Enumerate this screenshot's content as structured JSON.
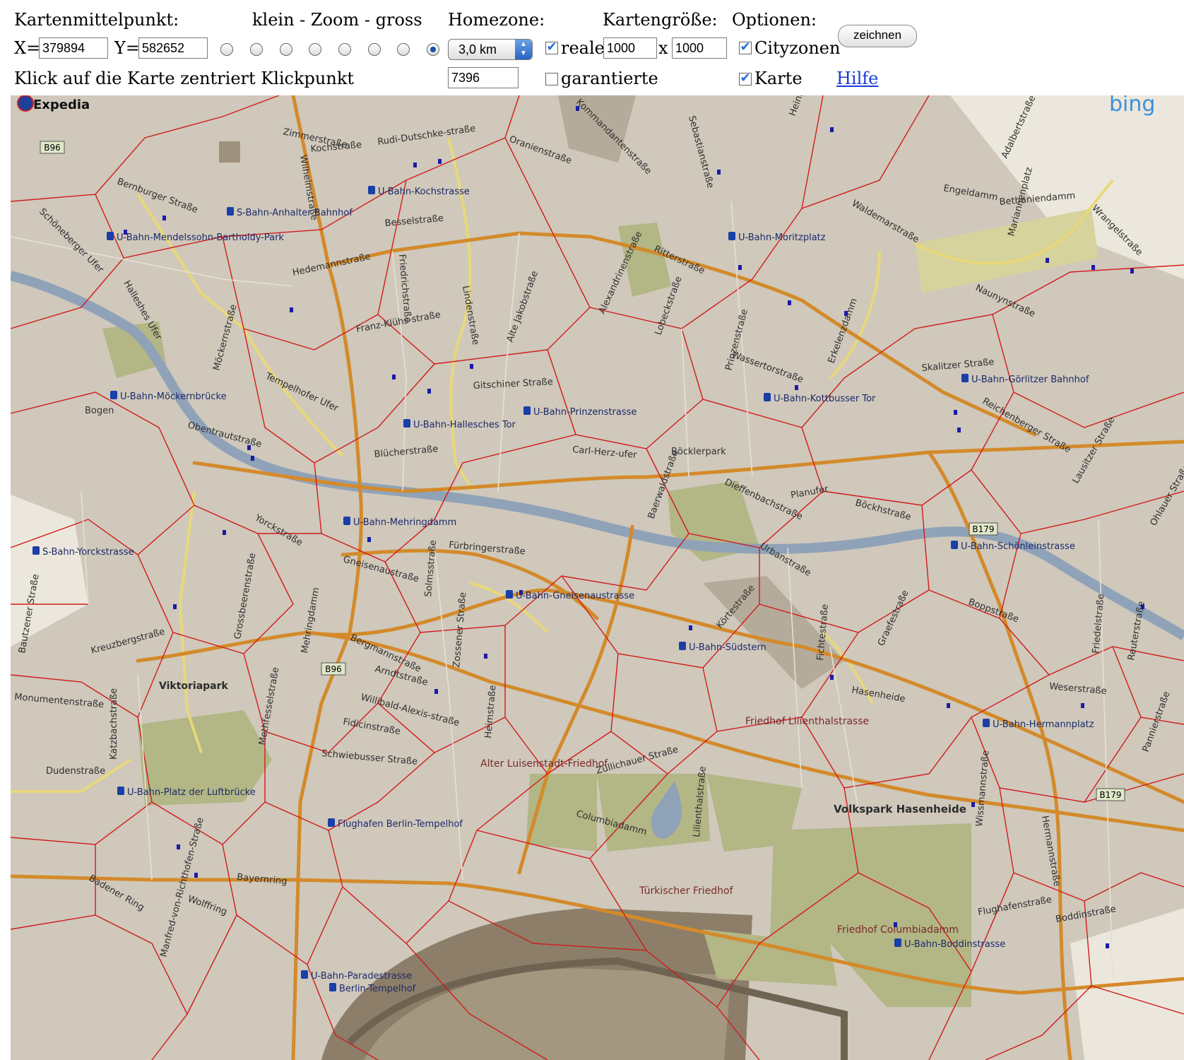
{
  "controls": {
    "center_label": "Kartenmittelpunkt:",
    "zoom_label": "klein - Zoom - gross",
    "homezone_label": "Homezone:",
    "size_label": "Kartengröße:",
    "options_label": "Optionen:",
    "x_prefix": "X=",
    "x_value": "379894",
    "y_prefix": "Y=",
    "y_value": "582652",
    "zoom_levels": 8,
    "zoom_selected": 8,
    "homezone_value": "3,0 km",
    "reale_checked": true,
    "reale_label": "reale",
    "width_value": "1000",
    "size_sep": "x",
    "height_value": "1000",
    "cityzonen_checked": true,
    "cityzonen_label": "Cityzonen",
    "draw_button": "zeichnen",
    "click_hint": "Klick auf die Karte zentriert Klickpunkt",
    "homezone_count": "7396",
    "garantierte_checked": false,
    "garantierte_label": "garantierte",
    "karte_checked": true,
    "karte_label": "Karte",
    "help_link": "Hilfe"
  },
  "map": {
    "colors": {
      "land": "#cfc8bb",
      "park": "#b3b685",
      "water": "#8fa2b8",
      "zone_lines": "#d21b1b",
      "main_roads": "#d48a2a",
      "yellow_roads": "#e8d87a",
      "label": "#333333",
      "poi": "#1b1ba8"
    },
    "logos": {
      "expedia": "Expedia",
      "bing": "bing"
    },
    "road_shields": [
      "B96",
      "B96",
      "B179",
      "B179"
    ],
    "street_labels": [
      "Zimmerstraße",
      "Kochstraße",
      "Rudi-Dutschke-straße",
      "Oranienstraße",
      "Kommandantenstraße",
      "Sebastianstraße",
      "Heinrich-Heine-Straße",
      "Adalbertstraße",
      "Engeldamm",
      "Bethaniendamm",
      "Waldemarstraße",
      "Wrangelstraße",
      "Mariannenplatz",
      "Bernburger Straße",
      "Schöneberger Ufer",
      "Wilhelmstraße",
      "Besselstraße",
      "Hedemannstraße",
      "Friedrichstraße",
      "Ritterstraße",
      "Alexandrinenstraße",
      "Naunynstraße",
      "Lindenstraße",
      "Alte Jakobstraße",
      "Franz-Klühs-straße",
      "Lobeckstraße",
      "Prinzenstraße",
      "Wassertorstraße",
      "Erkelenzdamm",
      "Skalitzer Straße",
      "Halleshes Ufer",
      "Möckernstraße",
      "Tempelhofer Ufer",
      "Gitschiner Straße",
      "Reichenberger Straße",
      "Obentrautstraße",
      "Böckhstraße",
      "Carl-Herz-ufer",
      "Blücherstraße",
      "Baerwaldstraße",
      "Planufer",
      "Dieffenbachstraße",
      "Urbanstraße",
      "Yorckstraße",
      "Mehringdamm",
      "Fürbringerstraße",
      "Gneisenaustraße",
      "Solmsstraße",
      "Zossener Straße",
      "Bergmannstraße",
      "Kreuzbergstraße",
      "Grossbeerenstraße",
      "Körtestraße",
      "Fichtestraße",
      "Graefestraße",
      "Boppstraße",
      "Hasenheide",
      "Weserstraße",
      "Monumentenstraße",
      "Katzbachstraße",
      "Methfesselstraße",
      "Arndtstraße",
      "Willibald-Alexis-straße",
      "Fidicinstraße",
      "Schwiebusser Straße",
      "Heimstraße",
      "Züllichauer Straße",
      "Lilienthalstraße",
      "Dudenstraße",
      "Columbiadamm",
      "Badener Ring",
      "Bayernring",
      "Wolffring",
      "Flughafenstraße",
      "Boddinstraße",
      "Hermannstraße",
      "Friedelstraße",
      "Reuterstraße",
      "Pannierstraße",
      "Bautzener Straße",
      "Ohlauer Straße",
      "Lausitzer Straße",
      "Wissmannstraße",
      "Manfred-von-Richthofen-Straße"
    ],
    "station_labels": [
      "U-Bahn-Kochstrasse",
      "S-Bahn-Anhalter Bahnhof",
      "U-Bahn-Mendelssohn-Bartholdy-Park",
      "U-Bahn-Moritzplatz",
      "U-Bahn-Möckernbrücke",
      "U-Bahn-Hallesches Tor",
      "U-Bahn-Prinzenstrasse",
      "U-Bahn-Kottbusser Tor",
      "U-Bahn-Görlitzer Bahnhof",
      "U-Bahn-Mehringdamm",
      "S-Bahn-Yorckstrasse",
      "U-Bahn-Gneisenaustrasse",
      "U-Bahn-Südstern",
      "U-Bahn-Schönleinstrasse",
      "U-Bahn-Hermannplatz",
      "U-Bahn-Platz der Luftbrücke",
      "Flughafen Berlin-Tempelhof",
      "U-Bahn-Paradestrasse",
      "U-Bahn-Boddinstrasse",
      "Berlin-Tempelhof"
    ],
    "place_labels": [
      "Viktoriapark",
      "Alter Luisenstadt-Friedhof",
      "Friedhof Lilienthalstrasse",
      "Volkspark Hasenheide",
      "Türkischer Friedhof",
      "Friedhof Columbiadamm",
      "Böcklerpark",
      "Bogen"
    ]
  }
}
